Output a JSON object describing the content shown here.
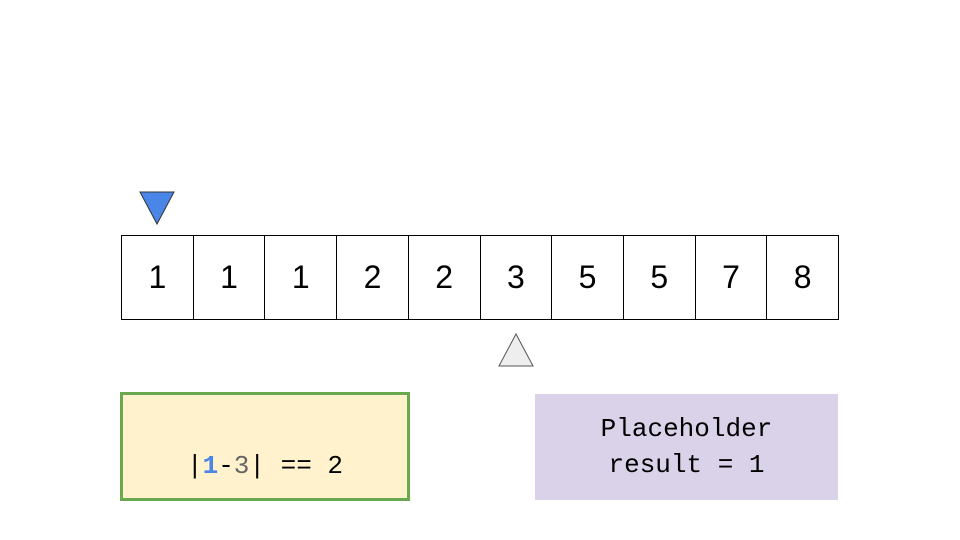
{
  "pointers": {
    "top": {
      "color": "#4a86e8",
      "index": 0
    },
    "bottom": {
      "color": "#eeeeee",
      "index": 5
    }
  },
  "array": [
    "1",
    "1",
    "1",
    "2",
    "2",
    "3",
    "5",
    "5",
    "7",
    "8"
  ],
  "expression": {
    "open": "|",
    "left": "1",
    "minus": "-",
    "right": "3",
    "close": "| == 2",
    "box_fill": "#fff2cc",
    "box_border": "#6aa84f",
    "highlight_color": "#4a86e8"
  },
  "result": {
    "line1": "Placeholder",
    "line2": "result = 1",
    "box_fill": "#d9d2e9"
  }
}
